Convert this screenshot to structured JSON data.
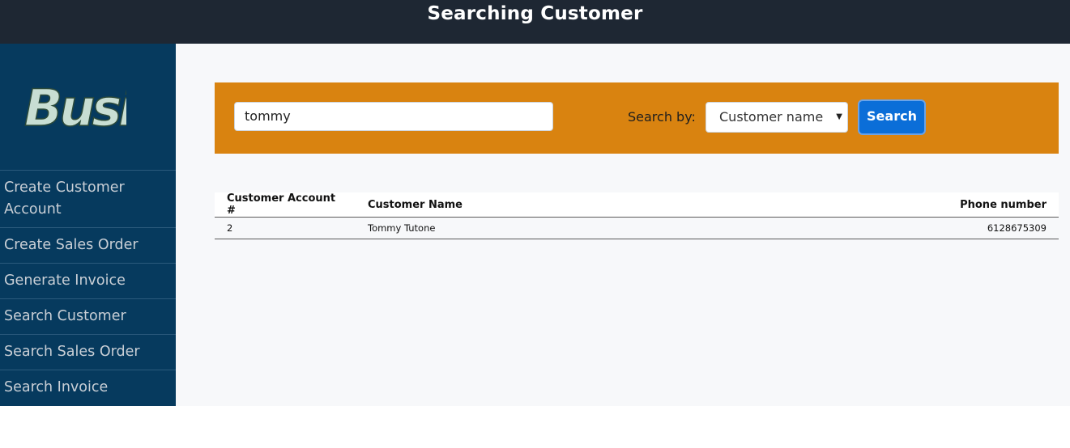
{
  "header": {
    "title": "Searching Customer"
  },
  "logo": {
    "text": "Busi"
  },
  "sidebar": {
    "items": [
      {
        "label": "Create Customer Account"
      },
      {
        "label": "Create Sales Order"
      },
      {
        "label": "Generate Invoice"
      },
      {
        "label": "Search Customer"
      },
      {
        "label": "Search Sales Order"
      },
      {
        "label": "Search Invoice"
      }
    ]
  },
  "search": {
    "value": "tommy",
    "search_by_label": "Search by:",
    "search_by_selected": "Customer name",
    "button_label": "Search"
  },
  "results": {
    "columns": [
      "Customer Account #",
      "Customer Name",
      "Phone number"
    ],
    "rows": [
      {
        "account": "2",
        "name": "Tommy Tutone",
        "phone": "6128675309"
      }
    ]
  },
  "colors": {
    "topbar": "#1e2733",
    "sidebar": "#063a5e",
    "searchbar": "#d98310",
    "button": "#0b6ed8"
  }
}
